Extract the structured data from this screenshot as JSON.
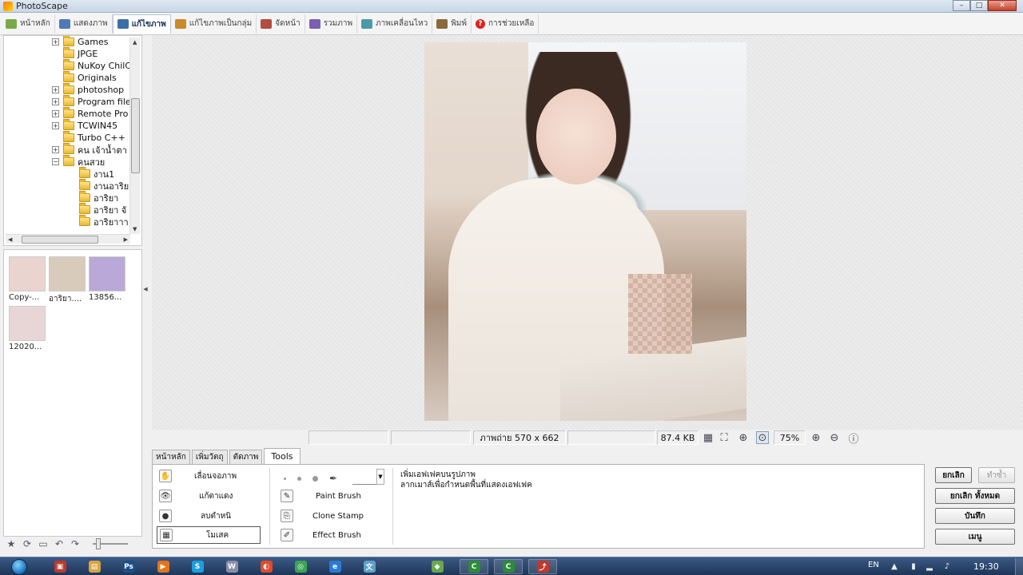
{
  "window": {
    "title": "PhotoScape",
    "controls": [
      "–",
      "□",
      "✕"
    ]
  },
  "main_tabs": [
    {
      "label": "หน้าหลัก",
      "color": "#7aa94a"
    },
    {
      "label": "แสดงภาพ",
      "color": "#4f79b8"
    },
    {
      "label": "แก้ไขภาพ",
      "color": "#3d6ea8",
      "active": true
    },
    {
      "label": "แก้ไขภาพเป็นกลุ่ม",
      "color": "#c98a2a"
    },
    {
      "label": "จัดหน้า",
      "color": "#b24d3f"
    },
    {
      "label": "รวมภาพ",
      "color": "#7b5fb0"
    },
    {
      "label": "ภาพเคลื่อนไหว",
      "color": "#4a9aa8"
    },
    {
      "label": "พิมพ์",
      "color": "#8a6a3c"
    },
    {
      "label": "การช่วยเหลือ",
      "color": "#d9241c"
    }
  ],
  "folder_tree": {
    "items": [
      {
        "label": "Games",
        "expander": "+"
      },
      {
        "label": "JPGE",
        "expander": ""
      },
      {
        "label": "NuKoy ChilC",
        "expander": ""
      },
      {
        "label": "Originals",
        "expander": ""
      },
      {
        "label": "photoshop",
        "expander": "+"
      },
      {
        "label": "Program file",
        "expander": "+"
      },
      {
        "label": "Remote Pro",
        "expander": "+"
      },
      {
        "label": "TCWIN45",
        "expander": "+"
      },
      {
        "label": "Turbo C++",
        "expander": ""
      },
      {
        "label": "คน เจ้าน้ำตา",
        "expander": "+"
      },
      {
        "label": "คนสวย",
        "expander": "−"
      },
      {
        "label": "งาน1",
        "expander": ""
      },
      {
        "label": "งานอาริย",
        "expander": ""
      },
      {
        "label": "อาริยา",
        "expander": ""
      },
      {
        "label": "อาริยา จั",
        "expander": ""
      },
      {
        "label": "อาริยาาา",
        "expander": ""
      }
    ]
  },
  "thumbnails": [
    {
      "label": "Copy-...",
      "tint": "#e9d4cf"
    },
    {
      "label": "อาริยา....",
      "tint": "#d9cbbb"
    },
    {
      "label": "13856...",
      "tint": "#b9a8d8"
    },
    {
      "label": "12020...",
      "tint": "#e8d6d6"
    }
  ],
  "statusbar": {
    "photo_info": "ภาพถ่าย 570 x 662",
    "file_size": "87.4 KB",
    "zoom": "75%"
  },
  "sub_tabs": [
    "หน้าหลัก",
    "เพิ่มวัตถุ",
    "ตัดภาพ",
    "Tools"
  ],
  "tools": {
    "left": [
      {
        "label": "เลื่อนจอภาพ",
        "icon": "✋"
      },
      {
        "label": "แก้ตาแดง",
        "icon": "👁"
      },
      {
        "label": "ลบตำหนิ",
        "icon": "●"
      },
      {
        "label": "โมเสค",
        "icon": "▦",
        "selected": true
      }
    ],
    "right": [
      {
        "label": "Paint Brush",
        "icon": "✎"
      },
      {
        "label": "Clone Stamp",
        "icon": "⎘"
      },
      {
        "label": "Effect Brush",
        "icon": "✐"
      }
    ],
    "description_line1": "เพิ่มเอฟเฟคบนรูปภาพ",
    "description_line2": "ลากเมาส์เพื่อกำหนดพื้นที่แสดงเอฟเฟค"
  },
  "buttons": {
    "cancel": "ยกเลิก",
    "redo": "ทำซ้ำ",
    "cancel_all": "ยกเลิก ทั้งหมด",
    "save": "บันทึก",
    "menu": "เมนู"
  },
  "taskbar": {
    "language": "EN",
    "time": "19:30",
    "apps": [
      {
        "glyph": "▣",
        "color": "#c0392b"
      },
      {
        "glyph": "▤",
        "color": "#d9a441"
      },
      {
        "glyph": "Ps",
        "color": "#1c4f86"
      },
      {
        "glyph": "▶",
        "color": "#e8731a"
      },
      {
        "glyph": "S",
        "color": "#1aa0e0"
      },
      {
        "glyph": "W",
        "color": "#8a8fa8"
      },
      {
        "glyph": "◐",
        "color": "#e24a2b"
      },
      {
        "glyph": "◎",
        "color": "#3aa655"
      },
      {
        "glyph": "e",
        "color": "#2b7ad6"
      },
      {
        "glyph": "文",
        "color": "#5ba1c9"
      },
      {
        "glyph": "◆",
        "color": "#6aa84f"
      },
      {
        "glyph": "C",
        "color": "#2e8b3a"
      },
      {
        "glyph": "C",
        "color": "#2e8b3a"
      },
      {
        "glyph": "⤴",
        "color": "#c0392b"
      }
    ]
  }
}
